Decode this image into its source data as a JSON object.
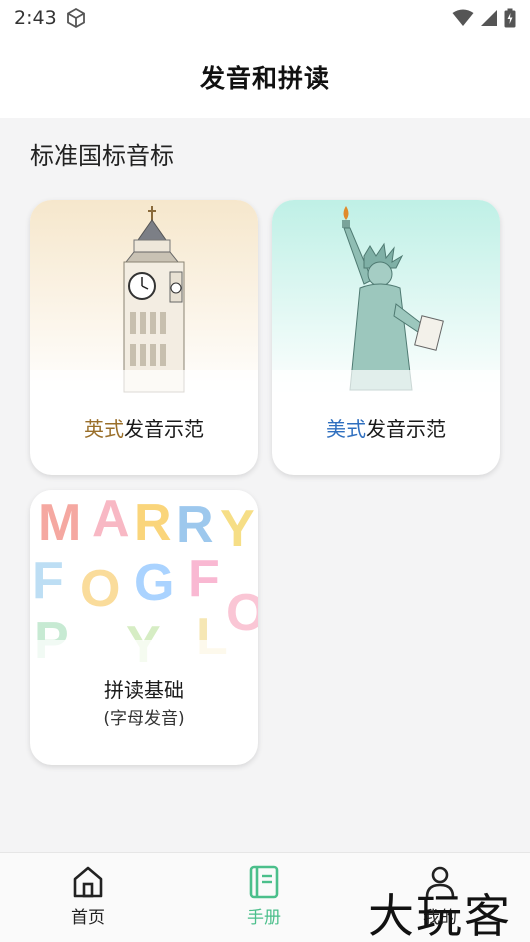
{
  "status_bar": {
    "time": "2:43"
  },
  "header": {
    "title": "发音和拼读"
  },
  "section": {
    "title": "标准国标音标"
  },
  "cards": [
    {
      "highlight": "英式",
      "label_rest": "发音示范",
      "highlight_color": "#9a6f2a"
    },
    {
      "highlight": "美式",
      "label_rest": "发音示范",
      "highlight_color": "#2f6fbf"
    },
    {
      "label": "拼读基础",
      "sublabel": "(字母发音)",
      "art_letters": [
        "M",
        "A",
        "R",
        "R",
        "Y",
        "F",
        "O",
        "G",
        "F",
        "O",
        "P",
        "Y",
        "L",
        "O"
      ]
    }
  ],
  "tabs": [
    {
      "label": "首页",
      "icon": "home-icon"
    },
    {
      "label": "手册",
      "icon": "book-icon",
      "active": true,
      "color": "#4bbf8b"
    },
    {
      "label": "我的",
      "icon": "person-icon"
    }
  ],
  "watermark": {
    "text": "大玩客"
  }
}
